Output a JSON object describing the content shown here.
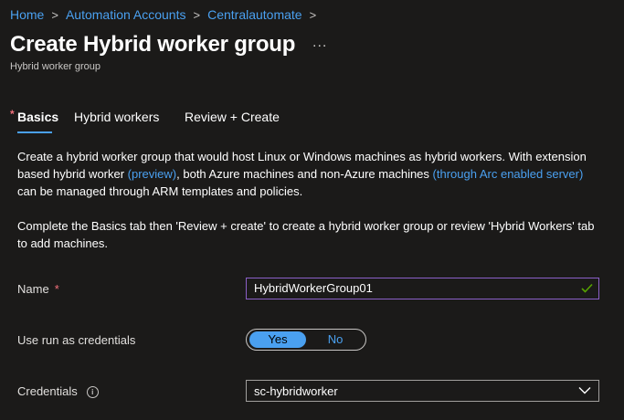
{
  "breadcrumb": {
    "items": [
      "Home",
      "Automation Accounts",
      "Centralautomate"
    ],
    "separator": ">"
  },
  "header": {
    "title": "Create Hybrid worker group",
    "more": "...",
    "subtitle": "Hybrid worker group"
  },
  "tabs": {
    "required_marker": "*",
    "items": [
      "Basics",
      "Hybrid workers",
      "Review + Create"
    ]
  },
  "description": {
    "p1_a": "Create a hybrid worker group that would host Linux or Windows machines as hybrid workers. With extension based hybrid worker ",
    "p1_link1": "(preview)",
    "p1_b": ", both Azure machines and non-Azure machines ",
    "p1_link2": "(through Arc enabled server)",
    "p1_c": " can be managed through ARM templates and policies.",
    "p2": "Complete the Basics tab then 'Review + create' to create a hybrid worker group or review 'Hybrid Workers' tab to add machines."
  },
  "form": {
    "name_label": "Name",
    "name_required": "*",
    "name_value": "HybridWorkerGroup01",
    "runas_label": "Use run as credentials",
    "runas_yes": "Yes",
    "runas_no": "No",
    "runas_selected": "Yes",
    "credentials_label": "Credentials",
    "credentials_info": "i",
    "credentials_value": "sc-hybridworker"
  },
  "colors": {
    "background": "#1b1a19",
    "accent": "#4aa0f0",
    "required": "#f1707b",
    "valid": "#57a300",
    "focus_border": "#8b5fc7"
  }
}
